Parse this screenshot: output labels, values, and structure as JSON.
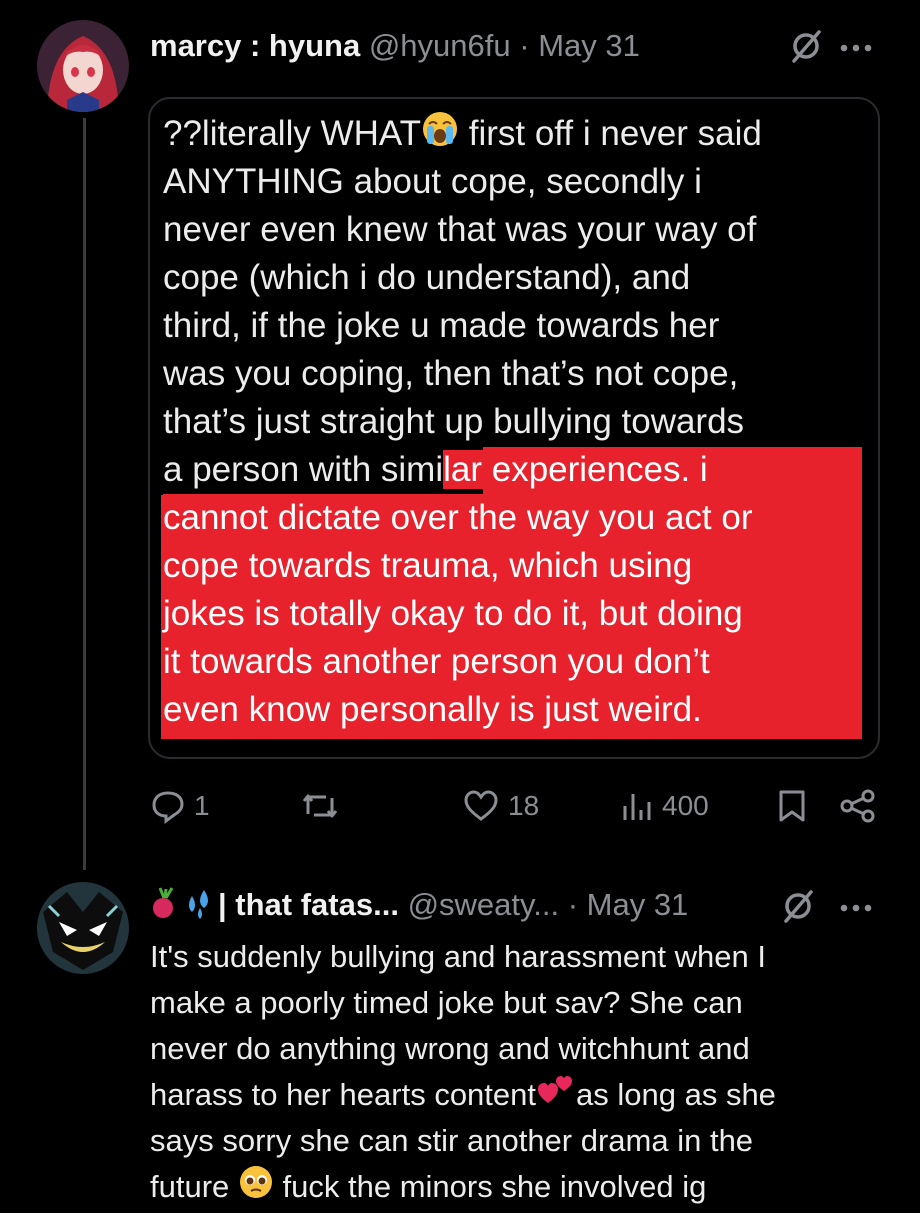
{
  "tweet1": {
    "display_name": "marcy : hyuna",
    "handle": "@hyun6fu",
    "separator": "·",
    "date": "May 31",
    "quote_lines": [
      {
        "a": "??literally WHAT",
        "b": " first off i never said"
      },
      {
        "a": "ANYTHING about cope, secondly i"
      },
      {
        "a": "never even knew that was your way of"
      },
      {
        "a": "cope (which i do understand), and"
      },
      {
        "a": "third, if the joke u made towards her"
      },
      {
        "a": "was you coping, then that’s not cope,"
      },
      {
        "a": "that’s just straight up bullying towards"
      },
      {
        "a": "a person with simi",
        "hl": "lar experiences. i"
      },
      {
        "hl": "cannot dictate over the way you act or"
      },
      {
        "hl": "cope towards trauma, which using"
      },
      {
        "hl": "jokes is totally okay to do it, but doing"
      },
      {
        "hl": "it towards another person you don’t"
      },
      {
        "hl": "even know personally is just weird."
      }
    ],
    "emoji": "loudly-crying-face-icon",
    "highlight_color": "#e8222c",
    "actions": {
      "reply_count": "1",
      "retweet_count": "",
      "like_count": "18",
      "view_count": "400"
    }
  },
  "tweet2": {
    "display_name": "| that fatas...",
    "handle": "@sweaty...",
    "separator": "·",
    "date": "May 31",
    "lines": [
      {
        "a": "It's suddenly bullying and harassment when I"
      },
      {
        "a": "make a poorly timed joke but sav? She can"
      },
      {
        "a": "never do anything wrong and witchhunt and"
      },
      {
        "a": "harass to her hearts content",
        "b": "as long as she"
      },
      {
        "a": "says sorry she can stir another drama in the"
      },
      {
        "a": "future",
        "b": " fuck the minors she involved ig"
      }
    ]
  },
  "colors": {
    "background": "#000000",
    "text": "#e7e9ea",
    "muted": "#8b8f94",
    "highlight": "#e8222c"
  }
}
